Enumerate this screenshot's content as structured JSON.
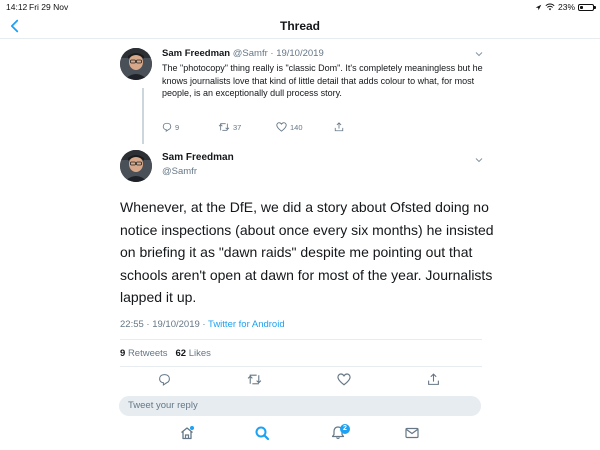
{
  "status_bar": {
    "time": "14:12",
    "date": "Fri 29 Nov",
    "battery": "23%",
    "battery_level": 0.23
  },
  "nav": {
    "title": "Thread",
    "back_icon": "chevron-left-icon"
  },
  "reply_tweet": {
    "name": "Sam Freedman",
    "handle_date": "@Samfr · 19/10/2019",
    "text": "The \"photocopy\" thing really is \"classic Dom\". It's completely meaningless but he knows journalists love that kind of little detail that adds colour to what, for most people, is an exceptionally dull process story.",
    "replies": "9",
    "retweets": "37",
    "likes": "140"
  },
  "main_tweet": {
    "name": "Sam Freedman",
    "handle": "@Samfr",
    "text": "Whenever, at the DfE, we did a story about Ofsted doing no notice inspections (about once every six months) he insisted on briefing it as \"dawn raids\" despite me pointing out that schools aren't open at dawn for most of the year. Journalists lapped it up.",
    "timestamp": "22:55 · 19/10/2019 · ",
    "source": "Twitter for Android",
    "retweets_count": "9",
    "retweets_label": "Retweets",
    "likes_count": "62",
    "likes_label": "Likes"
  },
  "composer": {
    "placeholder": "Tweet your reply"
  },
  "tab_bar": {
    "notification_count": "2",
    "icons": [
      "home-icon",
      "search-icon",
      "notifications-icon",
      "messages-icon"
    ]
  },
  "colors": {
    "accent": "#1da1f2",
    "text": "#14171a",
    "muted": "#657786",
    "divider": "#e6ecf0"
  }
}
